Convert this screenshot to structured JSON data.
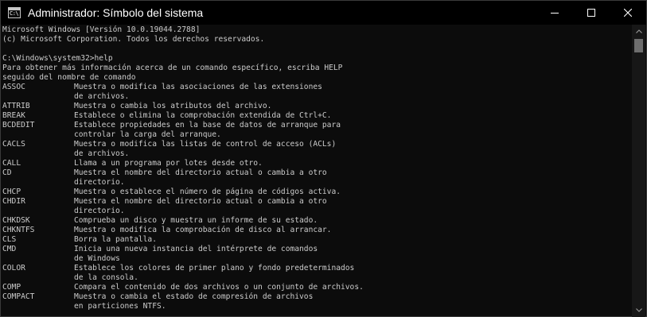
{
  "window": {
    "title": "Administrador: Símbolo del sistema",
    "icon_text": "C:\\"
  },
  "console": {
    "header": [
      "Microsoft Windows [Versión 10.0.19044.2788]",
      "(c) Microsoft Corporation. Todos los derechos reservados.",
      "",
      "C:\\Windows\\system32>help",
      "Para obtener más información acerca de un comando específico, escriba HELP",
      "seguido del nombre de comando"
    ],
    "commands": [
      {
        "name": "ASSOC",
        "desc": [
          "Muestra o modifica las asociaciones de las extensiones",
          "de archivos."
        ]
      },
      {
        "name": "ATTRIB",
        "desc": [
          "Muestra o cambia los atributos del archivo."
        ]
      },
      {
        "name": "BREAK",
        "desc": [
          "Establece o elimina la comprobación extendida de Ctrl+C."
        ]
      },
      {
        "name": "BCDEDIT",
        "desc": [
          "Establece propiedades en la base de datos de arranque para",
          "controlar la carga del arranque."
        ]
      },
      {
        "name": "CACLS",
        "desc": [
          "Muestra o modifica las listas de control de acceso (ACLs)",
          "de archivos."
        ]
      },
      {
        "name": "CALL",
        "desc": [
          "Llama a un programa por lotes desde otro."
        ]
      },
      {
        "name": "CD",
        "desc": [
          "Muestra el nombre del directorio actual o cambia a otro",
          "directorio."
        ]
      },
      {
        "name": "CHCP",
        "desc": [
          "Muestra o establece el número de página de códigos activa."
        ]
      },
      {
        "name": "CHDIR",
        "desc": [
          "Muestra el nombre del directorio actual o cambia a otro",
          "directorio."
        ]
      },
      {
        "name": "CHKDSK",
        "desc": [
          "Comprueba un disco y muestra un informe de su estado."
        ]
      },
      {
        "name": "CHKNTFS",
        "desc": [
          "Muestra o modifica la comprobación de disco al arrancar."
        ]
      },
      {
        "name": "CLS",
        "desc": [
          "Borra la pantalla."
        ]
      },
      {
        "name": "CMD",
        "desc": [
          "Inicia una nueva instancia del intérprete de comandos",
          "de Windows"
        ]
      },
      {
        "name": "COLOR",
        "desc": [
          "Establece los colores de primer plano y fondo predeterminados",
          "de la consola."
        ]
      },
      {
        "name": "COMP",
        "desc": [
          "Compara el contenido de dos archivos o un conjunto de archivos."
        ]
      },
      {
        "name": "COMPACT",
        "desc": [
          "Muestra o cambia el estado de compresión de archivos",
          "en particiones NTFS."
        ]
      }
    ]
  },
  "colors": {
    "background": "#0c0c0c",
    "text": "#cccccc",
    "titlebar": "#000000"
  }
}
